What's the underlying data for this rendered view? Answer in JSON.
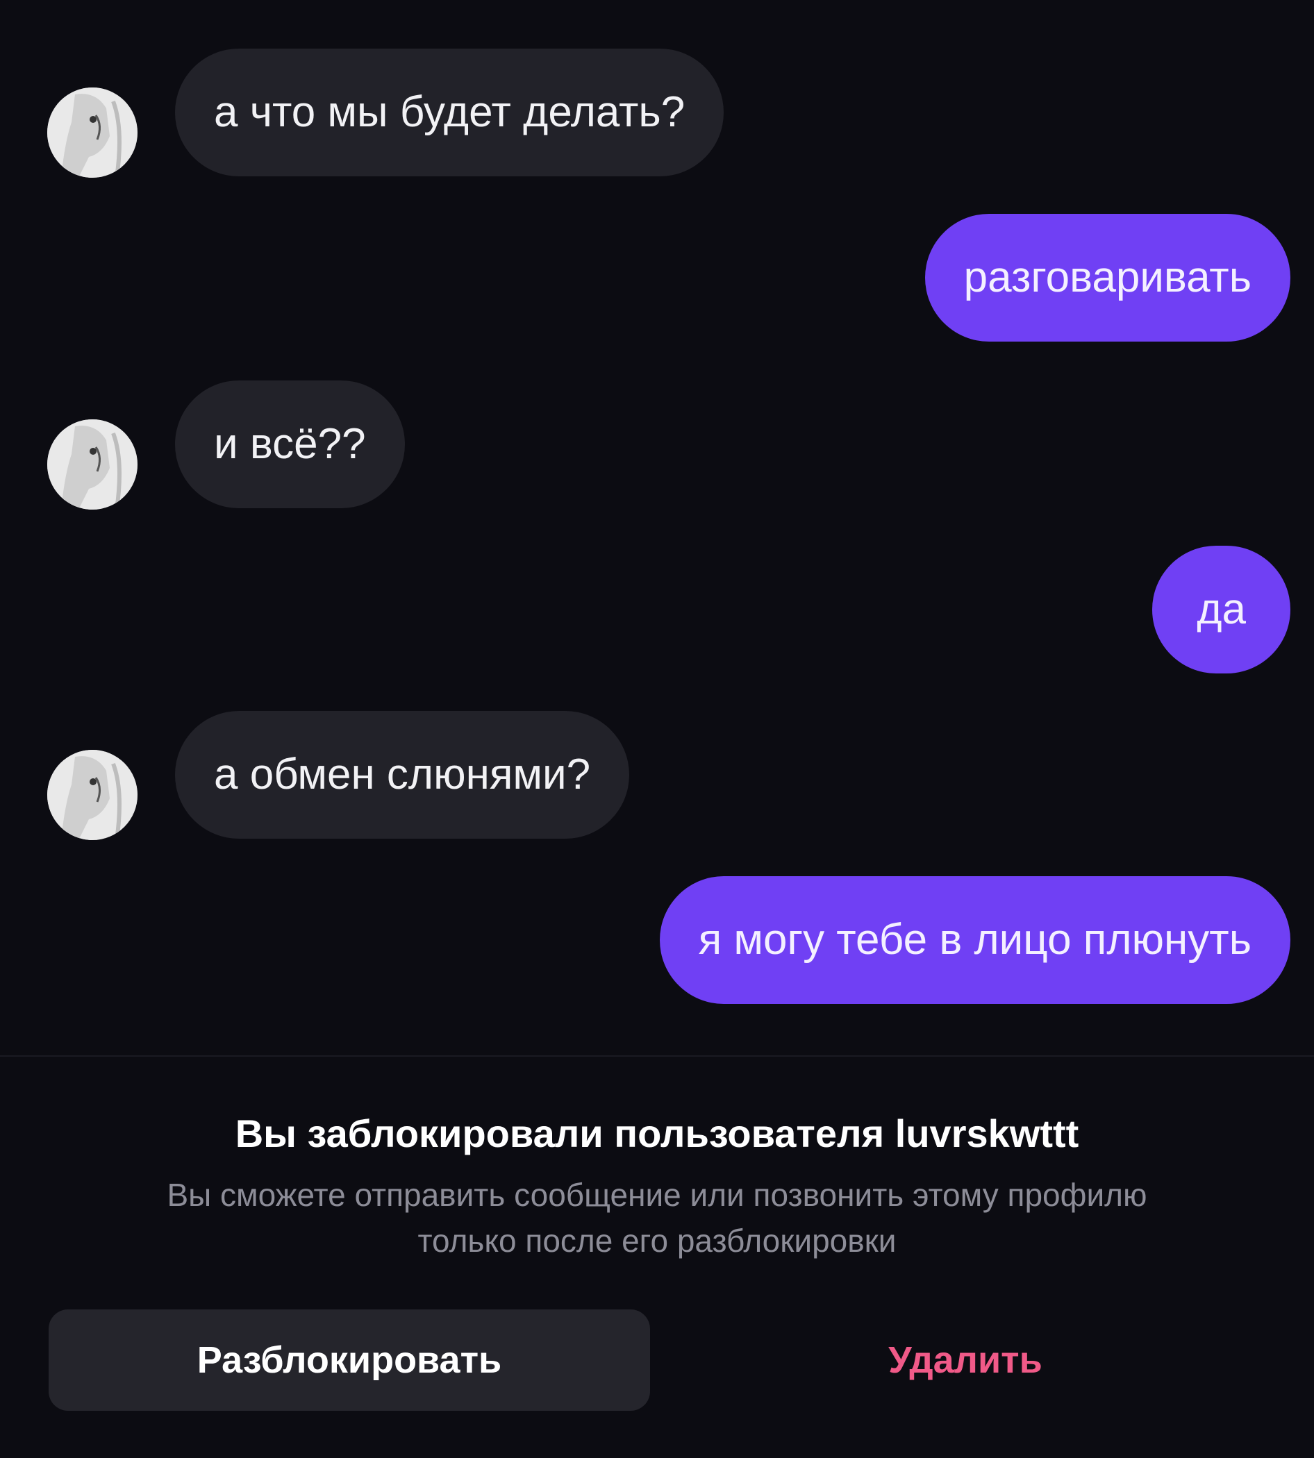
{
  "conversation": {
    "messages": [
      {
        "direction": "incoming",
        "text": "а что мы будет делать?"
      },
      {
        "direction": "outgoing",
        "text": "разговаривать"
      },
      {
        "direction": "incoming",
        "text": "и всё??"
      },
      {
        "direction": "outgoing",
        "text": "да"
      },
      {
        "direction": "incoming",
        "text": "а обмен слюнями?"
      },
      {
        "direction": "outgoing",
        "text": "я могу тебе в лицо плюнуть"
      }
    ]
  },
  "block_notice": {
    "title": "Вы заблокировали пользователя luvrskwttt",
    "description": "Вы сможете отправить сообщение или позвонить этому профилю только после его разблокировки",
    "unblock_label": "Разблокировать",
    "delete_label": "Удалить"
  },
  "colors": {
    "background": "#0c0c12",
    "incoming_bubble": "#222229",
    "outgoing_bubble": "#7040f4",
    "delete_text": "#f05a88",
    "secondary_text": "#8d8d98"
  },
  "icons": {
    "contact_avatar": "avatar-photo"
  }
}
